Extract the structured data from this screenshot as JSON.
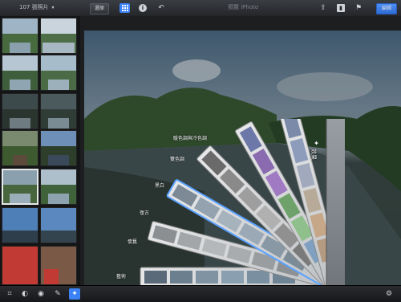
{
  "topbar": {
    "count_label": "107 張照片",
    "edit_button": "還原",
    "title": "預覽 iPhoto",
    "done_button": "編輯"
  },
  "fan": {
    "header": "效果",
    "items": [
      "暖色調與冷色調",
      "雙色調",
      "黑白",
      "復古",
      "懷舊",
      "藝術"
    ]
  },
  "colors": {
    "accent": "#3b82f6",
    "selection_glow": "#5aa2ff"
  },
  "icons": {
    "grid": "grid-icon",
    "info": "info-icon",
    "undo": "undo-icon",
    "share": "share-icon",
    "crop": "crop-icon",
    "exposure": "exposure-icon",
    "color": "color-icon",
    "brushes": "brush-icon",
    "effects": "effects-icon",
    "settings": "gear-icon"
  }
}
